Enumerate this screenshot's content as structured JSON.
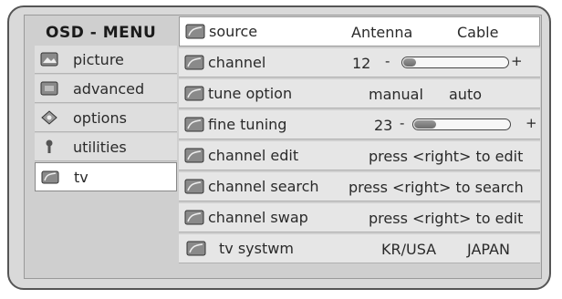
{
  "menu": {
    "title": "OSD - MENU",
    "items": [
      {
        "label": "picture",
        "icon": "picture-icon"
      },
      {
        "label": "advanced",
        "icon": "advanced-icon"
      },
      {
        "label": "options",
        "icon": "options-icon"
      },
      {
        "label": "utilities",
        "icon": "utilities-icon"
      },
      {
        "label": "tv",
        "icon": "tv-icon",
        "selected": true
      }
    ]
  },
  "settings": {
    "source": {
      "label": "source",
      "option1": "Antenna",
      "option2": "Cable"
    },
    "channel": {
      "label": "channel",
      "value": "12",
      "minus": "-",
      "plus": "+",
      "level": 0.12
    },
    "tune_option": {
      "label": "tune option",
      "option1": "manual",
      "option2": "auto"
    },
    "fine_tuning": {
      "label": "fine tuning",
      "value": "23",
      "minus": "-",
      "plus": "+",
      "level": 0.23
    },
    "channel_edit": {
      "label": "channel edit",
      "hint": "press <right> to edit"
    },
    "channel_search": {
      "label": "channel search",
      "hint": "press <right> to search"
    },
    "channel_swap": {
      "label": "channel swap",
      "hint": "press <right> to edit"
    },
    "tv_system": {
      "label": "tv systwm",
      "option1": "KR/USA",
      "option2": "JAPAN"
    }
  },
  "colors": {
    "highlight": "#ffffff",
    "panel": "#d9d9d9",
    "slider_fill": "#7a7a7a"
  }
}
